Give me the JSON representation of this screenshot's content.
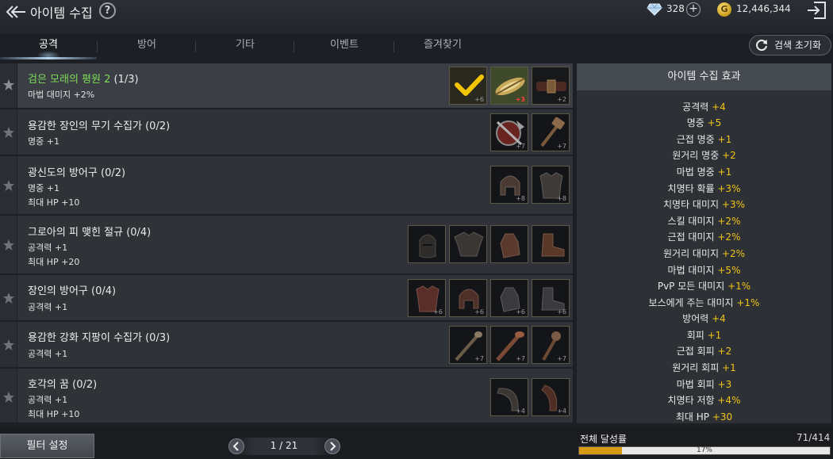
{
  "header": {
    "title": "아이템 수집",
    "help_icon": "question-icon",
    "gems": "328",
    "gold_symbol": "G",
    "gold": "12,446,344"
  },
  "tabs": [
    {
      "label": "공격",
      "active": true
    },
    {
      "label": "방어",
      "active": false
    },
    {
      "label": "기타",
      "active": false
    },
    {
      "label": "이벤트",
      "active": false
    },
    {
      "label": "즐겨찾기",
      "active": false
    }
  ],
  "reset_label": "검색 초기화",
  "collections": [
    {
      "name": "검은 모래의 평원 2",
      "progress": "(1/3)",
      "completed": true,
      "stats": [
        "마법 대미지 +2%"
      ],
      "items": [
        {
          "icon": "checkmark-icon",
          "level": "+6"
        },
        {
          "icon": "feather-bundle-icon",
          "level": "+3",
          "level_red": true
        },
        {
          "icon": "belt-icon",
          "level": "+2"
        }
      ]
    },
    {
      "name": "용감한 장인의 무기 수집가",
      "progress": "(0/2)",
      "completed": false,
      "stats": [
        "명중 +1"
      ],
      "items": [
        {
          "icon": "shield-axe-icon",
          "level": "+7"
        },
        {
          "icon": "hammer-icon",
          "level": "+7"
        }
      ]
    },
    {
      "name": "광신도의 방어구",
      "progress": "(0/2)",
      "completed": false,
      "stats": [
        "명중 +1",
        "최대 HP +10"
      ],
      "items": [
        {
          "icon": "helmet-icon",
          "level": "+8"
        },
        {
          "icon": "armor-icon",
          "level": "+8"
        }
      ]
    },
    {
      "name": "그로아의 피 맺힌 절규",
      "progress": "(0/4)",
      "completed": false,
      "stats": [
        "공격력 +1",
        "최대 HP +20"
      ],
      "items": [
        {
          "icon": "helmet-icon",
          "level": ""
        },
        {
          "icon": "armor-icon",
          "level": ""
        },
        {
          "icon": "gloves-icon",
          "level": ""
        },
        {
          "icon": "boots-icon",
          "level": ""
        }
      ]
    },
    {
      "name": "장인의 방어구",
      "progress": "(0/4)",
      "completed": false,
      "stats": [
        "공격력 +1"
      ],
      "items": [
        {
          "icon": "armor-icon",
          "level": "+6"
        },
        {
          "icon": "helmet-icon",
          "level": "+6"
        },
        {
          "icon": "gloves-icon",
          "level": "+6"
        },
        {
          "icon": "boots-icon",
          "level": "+6"
        }
      ]
    },
    {
      "name": "용감한 강화 지팡이 수집가",
      "progress": "(0/3)",
      "completed": false,
      "stats": [
        "공격력 +1"
      ],
      "items": [
        {
          "icon": "staff-icon",
          "level": "+7"
        },
        {
          "icon": "staff-icon",
          "level": "+7"
        },
        {
          "icon": "staff-icon",
          "level": "+7"
        }
      ]
    },
    {
      "name": "호각의 꿈",
      "progress": "(0/2)",
      "completed": false,
      "stats": [
        "공격력 +1",
        "최대 HP +10"
      ],
      "items": [
        {
          "icon": "horn-icon",
          "level": "+4"
        },
        {
          "icon": "horn-icon",
          "level": "+4"
        }
      ]
    }
  ],
  "effects_title": "아이템 수집 효과",
  "effects": [
    {
      "label": "공격력",
      "value": "+4"
    },
    {
      "label": "명중",
      "value": "+5"
    },
    {
      "label": "근접 명중",
      "value": "+1"
    },
    {
      "label": "원거리 명중",
      "value": "+2"
    },
    {
      "label": "마법 명중",
      "value": "+1"
    },
    {
      "label": "치명타 확률",
      "value": "+3%"
    },
    {
      "label": "치명타 대미지",
      "value": "+3%"
    },
    {
      "label": "스킬 대미지",
      "value": "+2%"
    },
    {
      "label": "근접 대미지",
      "value": "+2%"
    },
    {
      "label": "원거리 대미지",
      "value": "+2%"
    },
    {
      "label": "마법 대미지",
      "value": "+5%"
    },
    {
      "label": "PvP 모든 대미지",
      "value": "+1%"
    },
    {
      "label": "보스에게 주는 대미지",
      "value": "+1%"
    },
    {
      "label": "방어력",
      "value": "+4"
    },
    {
      "label": "회피",
      "value": "+1"
    },
    {
      "label": "근접 회피",
      "value": "+2"
    },
    {
      "label": "원거리 회피",
      "value": "+1"
    },
    {
      "label": "마법 회피",
      "value": "+3"
    },
    {
      "label": "치명타 저항",
      "value": "+4%"
    },
    {
      "label": "최대 HP",
      "value": "+30"
    }
  ],
  "footer": {
    "filter_label": "필터 설정",
    "page": "1 / 21",
    "achievement_label": "전체 달성률",
    "achievement_count": "71/414",
    "achievement_percent": "17%",
    "achievement_fraction": 0.17
  },
  "colors": {
    "completed_name": "#7ed957",
    "effect_value": "#f0c419",
    "progress_fill": "#d89a12"
  }
}
